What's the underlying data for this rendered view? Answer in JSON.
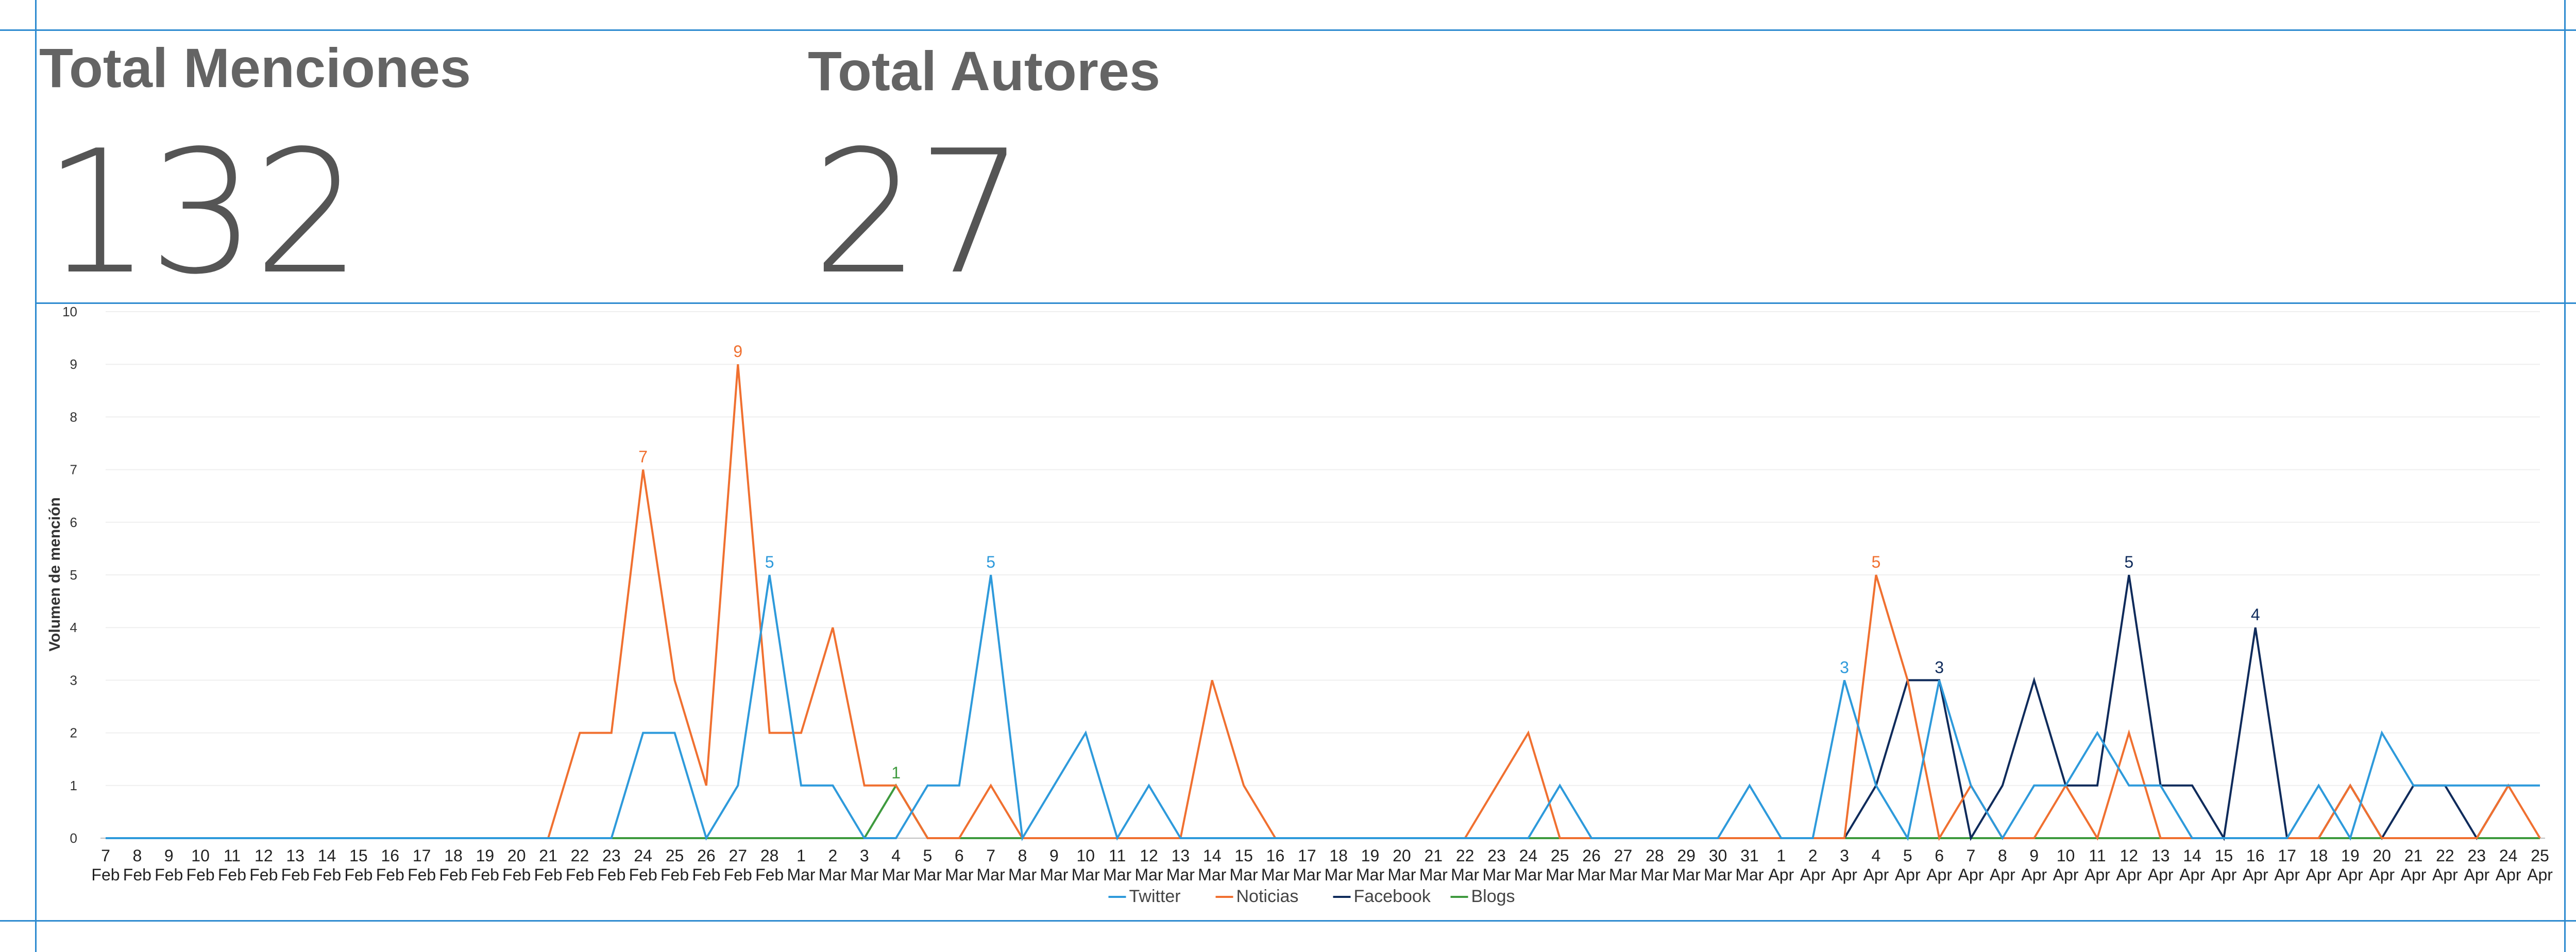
{
  "kpis": {
    "menciones": {
      "title": "Total Menciones",
      "value": "132"
    },
    "autores": {
      "title": "Total Autores",
      "value": "27"
    }
  },
  "colors": {
    "frame": "#2E8BD0",
    "Twitter": "#2E9ADB",
    "Noticias": "#F07030",
    "Facebook": "#0F2B5B",
    "Blogs": "#3E9A3E"
  },
  "chart_data": {
    "type": "line",
    "ylabel": "Volumen de mención",
    "xlabel": "",
    "ylim": [
      0,
      10
    ],
    "yticks": [
      0,
      1,
      2,
      3,
      4,
      5,
      6,
      7,
      8,
      9,
      10
    ],
    "grid": true,
    "legend": "bottom",
    "categories": [
      "7 Feb",
      "8 Feb",
      "9 Feb",
      "10 Feb",
      "11 Feb",
      "12 Feb",
      "13 Feb",
      "14 Feb",
      "15 Feb",
      "16 Feb",
      "17 Feb",
      "18 Feb",
      "19 Feb",
      "20 Feb",
      "21 Feb",
      "22 Feb",
      "23 Feb",
      "24 Feb",
      "25 Feb",
      "26 Feb",
      "27 Feb",
      "28 Feb",
      "1 Mar",
      "2 Mar",
      "3 Mar",
      "4 Mar",
      "5 Mar",
      "6 Mar",
      "7 Mar",
      "8 Mar",
      "9 Mar",
      "10 Mar",
      "11 Mar",
      "12 Mar",
      "13 Mar",
      "14 Mar",
      "15 Mar",
      "16 Mar",
      "17 Mar",
      "18 Mar",
      "19 Mar",
      "20 Mar",
      "21 Mar",
      "22 Mar",
      "23 Mar",
      "24 Mar",
      "25 Mar",
      "26 Mar",
      "27 Mar",
      "28 Mar",
      "29 Mar",
      "30 Mar",
      "31 Mar",
      "1 Apr",
      "2 Apr",
      "3 Apr",
      "4 Apr",
      "5 Apr",
      "6 Apr",
      "7 Apr",
      "8 Apr",
      "9 Apr",
      "10 Apr",
      "11 Apr",
      "12 Apr",
      "13 Apr",
      "14 Apr",
      "15 Apr",
      "16 Apr",
      "17 Apr",
      "18 Apr",
      "19 Apr",
      "20 Apr",
      "21 Apr",
      "22 Apr",
      "23 Apr",
      "24 Apr",
      "25 Apr"
    ],
    "series": [
      {
        "name": "Twitter",
        "start": 0,
        "values": [
          0,
          0,
          0,
          0,
          0,
          0,
          0,
          0,
          0,
          0,
          0,
          0,
          0,
          0,
          0,
          0,
          0,
          2,
          2,
          0,
          1,
          5,
          1,
          1,
          0,
          0,
          1,
          1,
          5,
          0,
          1,
          2,
          0,
          1,
          0,
          0,
          0,
          0,
          0,
          0,
          0,
          0,
          0,
          0,
          0,
          0,
          1,
          0,
          0,
          0,
          0,
          0,
          1,
          0,
          0,
          3,
          1,
          0,
          3,
          1,
          0,
          1,
          1,
          2,
          1,
          1,
          0,
          0,
          0,
          0,
          1,
          0,
          2,
          1,
          1,
          1,
          1,
          1
        ],
        "labels": [
          {
            "index": 21,
            "text": "5"
          },
          {
            "index": 28,
            "text": "5"
          },
          {
            "index": 55,
            "text": "3"
          }
        ]
      },
      {
        "name": "Noticias",
        "start": 0,
        "values": [
          0,
          0,
          0,
          0,
          0,
          0,
          0,
          0,
          0,
          0,
          0,
          0,
          0,
          0,
          0,
          2,
          2,
          7,
          3,
          1,
          9,
          2,
          2,
          4,
          1,
          1,
          0,
          0,
          1,
          0,
          0,
          0,
          0,
          0,
          0,
          3,
          1,
          0,
          0,
          0,
          0,
          0,
          0,
          0,
          1,
          2,
          0,
          0,
          0,
          0,
          0,
          0,
          0,
          0,
          0,
          0,
          5,
          3,
          0,
          1,
          0,
          0,
          1,
          0,
          2,
          0,
          0,
          0,
          0,
          0,
          0,
          1,
          0,
          0,
          0,
          0,
          1,
          0
        ],
        "labels": [
          {
            "index": 17,
            "text": "7"
          },
          {
            "index": 20,
            "text": "9"
          },
          {
            "index": 56,
            "text": "5"
          }
        ]
      },
      {
        "name": "Facebook",
        "start": 55,
        "values": [
          0,
          1,
          3,
          3,
          0,
          1,
          3,
          1,
          1,
          5,
          1,
          1,
          0,
          4,
          0,
          0,
          1,
          0,
          1,
          1,
          0,
          1
        ],
        "labels": [
          {
            "index": 58,
            "text": "3"
          },
          {
            "index": 64,
            "text": "5"
          },
          {
            "index": 68,
            "text": "4"
          }
        ]
      },
      {
        "name": "Blogs",
        "start": 0,
        "values": [
          0,
          0,
          0,
          0,
          0,
          0,
          0,
          0,
          0,
          0,
          0,
          0,
          0,
          0,
          0,
          0,
          0,
          0,
          0,
          0,
          0,
          0,
          0,
          0,
          0,
          1,
          0,
          0,
          0,
          0,
          0,
          0,
          0,
          0,
          0,
          0,
          0,
          0,
          0,
          0,
          0,
          0,
          0,
          0,
          0,
          0,
          0,
          0,
          0,
          0,
          0,
          0,
          0,
          0,
          0,
          0,
          0,
          0,
          0,
          0,
          0,
          0,
          0,
          0,
          0,
          0,
          0,
          0,
          0,
          0,
          0,
          0,
          0,
          0,
          0,
          0,
          0,
          0
        ],
        "labels": [
          {
            "index": 25,
            "text": "1"
          }
        ]
      }
    ]
  }
}
